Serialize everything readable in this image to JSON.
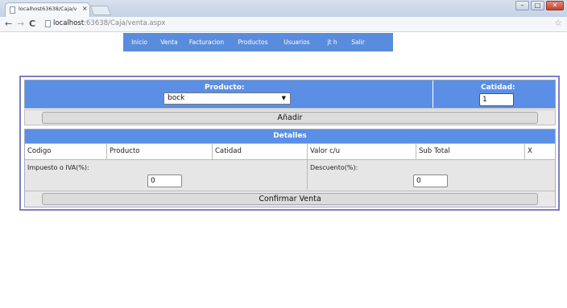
{
  "browser": {
    "tab_title": "localhost63638/Caja/ven",
    "tab_close": "×",
    "url_host": "localhost",
    "url_path": ":63638/Caja/venta.aspx",
    "back": "←",
    "forward": "→",
    "reload": "C",
    "star": "☆"
  },
  "nav": {
    "items": [
      "Inicio",
      "Venta",
      "Facturacion",
      "Productos",
      "Usuarios",
      "jt h",
      "Salir"
    ]
  },
  "form": {
    "producto_label": "Producto:",
    "producto_value": "bock",
    "cantidad_label": "Catidad:",
    "cantidad_value": "1",
    "add_button": "Añadir"
  },
  "details": {
    "title": "Detalles",
    "columns": [
      "Codigo",
      "Producto",
      "Catidad",
      "Valor c/u",
      "Sub Total",
      "X"
    ],
    "impuesto_label": "Impuesto o IVA(%):",
    "impuesto_value": "0",
    "descuento_label": "Descuento(%):",
    "descuento_value": "0",
    "confirm_button": "Confirmar Venta"
  },
  "colors": {
    "nav_bg": "#5a8cde",
    "header_bg": "#5b8fe6",
    "panel_border": "#7b7fc2"
  }
}
